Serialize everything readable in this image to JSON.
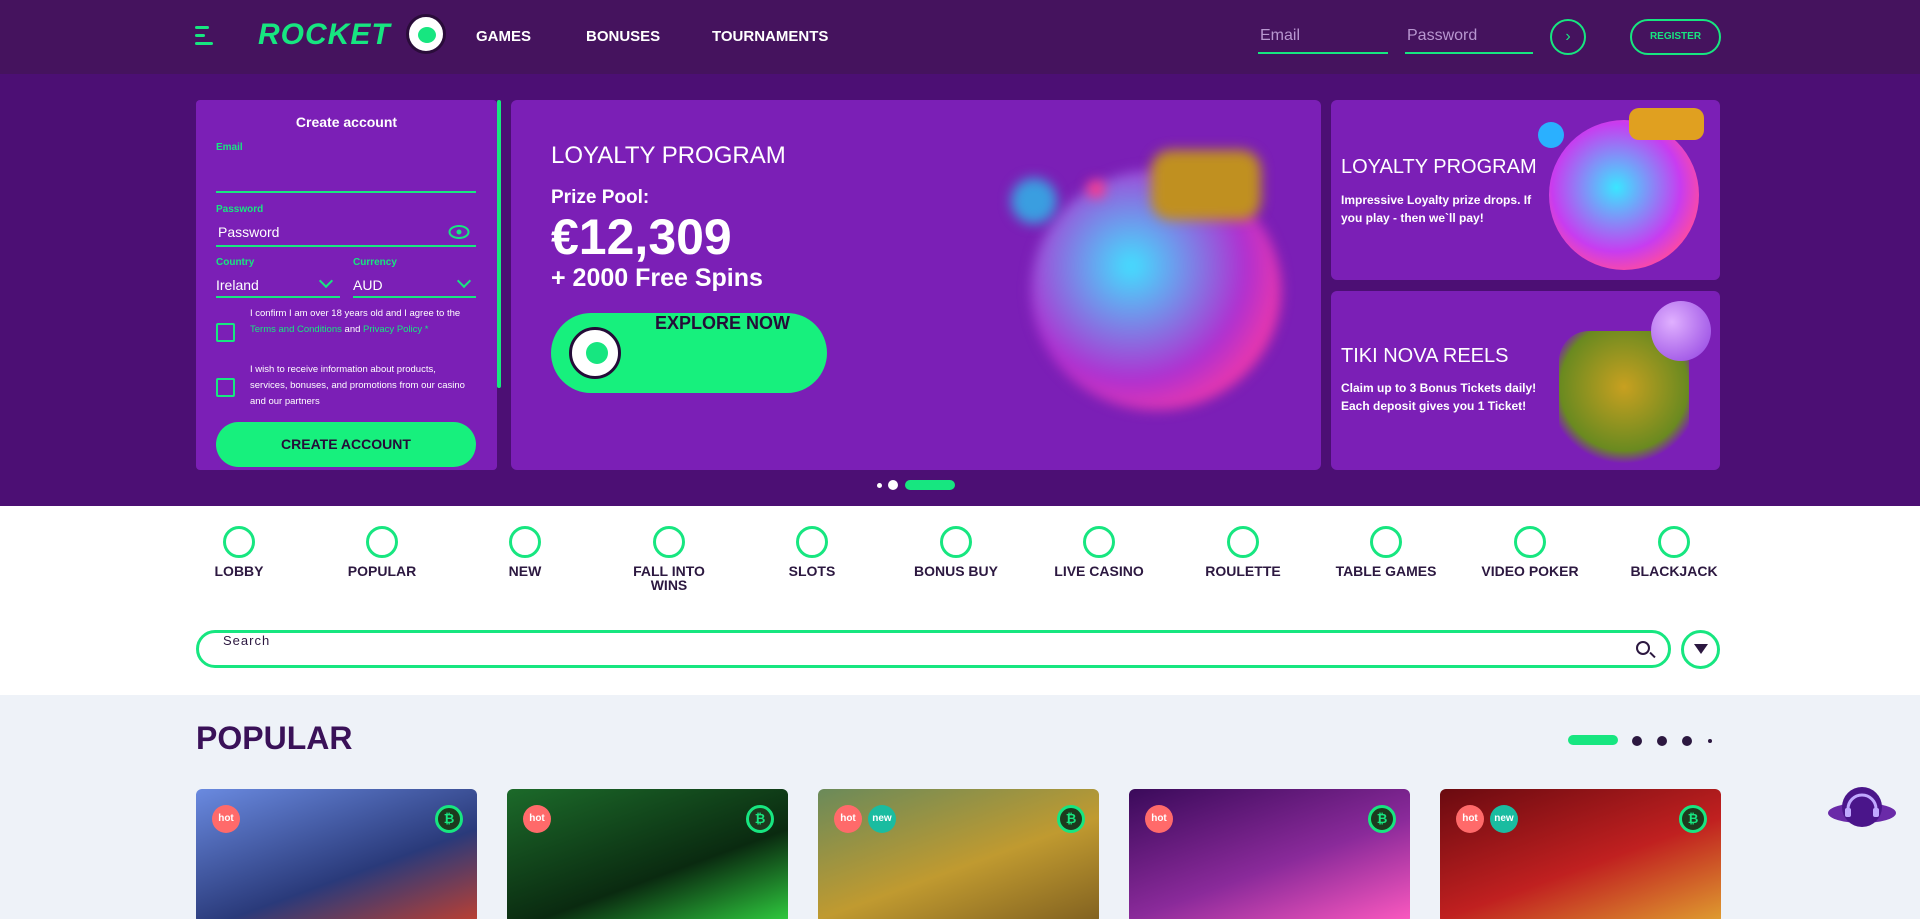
{
  "header": {
    "logo": "ROCKET",
    "nav": [
      "GAMES",
      "BONUSES",
      "TOURNAMENTS"
    ],
    "email_placeholder": "Email",
    "password_placeholder": "Password",
    "go_icon": "›",
    "register": "REGISTER"
  },
  "form": {
    "title": "Create account",
    "email_label": "Email",
    "password_label": "Password",
    "password_value": "Password",
    "country_label": "Country",
    "country_value": "Ireland",
    "currency_label": "Currency",
    "currency_value": "AUD",
    "check1_a": "I confirm I am over 18 years old and I agree to the ",
    "check1_terms": "Terms and Conditions",
    "check1_and": " and ",
    "check1_privacy": "Privacy Policy *",
    "check2": "I wish to receive information about products, services, bonuses, and promotions from our casino and our partners",
    "button": "CREATE ACCOUNT"
  },
  "banner": {
    "title": "LOYALTY PROGRAM",
    "prize_label": "Prize Pool:",
    "amount": "€12,309",
    "spins": "+ 2000 Free Spins",
    "cta": "EXPLORE NOW"
  },
  "side_cards": [
    {
      "title": "LOYALTY PROGRAM",
      "desc": "Impressive Loyalty prize drops. If you play - then we`ll pay!"
    },
    {
      "title": "TIKI NOVA REELS",
      "desc": "Claim up to 3 Bonus Tickets daily! Each deposit gives you 1 Ticket!"
    }
  ],
  "categories": [
    {
      "label": "LOBBY",
      "icon": "lobby-icon"
    },
    {
      "label": "POPULAR",
      "icon": "flame-icon"
    },
    {
      "label": "NEW",
      "icon": "new-icon"
    },
    {
      "label": "FALL INTO WINS",
      "icon": "heart-icon"
    },
    {
      "label": "SLOTS",
      "icon": "seven-icon"
    },
    {
      "label": "BONUS BUY",
      "icon": "gift-icon"
    },
    {
      "label": "LIVE CASINO",
      "icon": "chip-icon"
    },
    {
      "label": "ROULETTE",
      "icon": "roulette-icon"
    },
    {
      "label": "TABLE GAMES",
      "icon": "dice-icon"
    },
    {
      "label": "VIDEO POKER",
      "icon": "play-icon"
    },
    {
      "label": "BLACKJACK",
      "icon": "club-icon"
    }
  ],
  "search": {
    "placeholder": "Search"
  },
  "popular": {
    "title": "POPULAR",
    "cards": [
      {
        "badges": [
          "hot"
        ],
        "btc": "₿"
      },
      {
        "badges": [
          "hot"
        ],
        "btc": "₿"
      },
      {
        "badges": [
          "hot",
          "new"
        ],
        "btc": "₿"
      },
      {
        "badges": [
          "hot"
        ],
        "btc": "₿"
      },
      {
        "badges": [
          "hot",
          "new"
        ],
        "btc": "₿"
      }
    ]
  },
  "colors": {
    "accent": "#17e680",
    "header": "#45135e",
    "hero": "#4c0f74",
    "panel": "#7b1fb6",
    "dark": "#2c1840"
  }
}
